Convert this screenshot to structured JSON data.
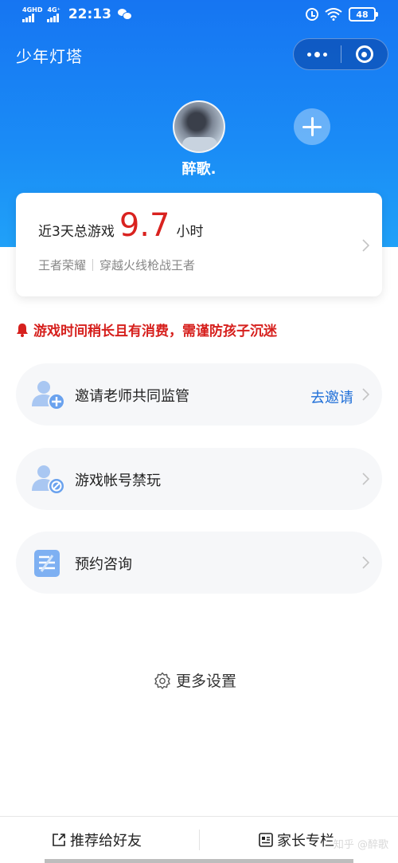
{
  "status_bar": {
    "network_1": "4GHD",
    "network_2": "4G⁺",
    "time": "22:13",
    "battery": "48",
    "icons": [
      "signal-icon",
      "wechat-icon",
      "alarm-icon",
      "wifi-icon",
      "battery-icon"
    ]
  },
  "header": {
    "title": "少年灯塔",
    "capsule_icons": [
      "more-dots-icon",
      "close-target-icon"
    ],
    "gradient": [
      "#1675f2",
      "#20a1f8"
    ]
  },
  "profile": {
    "name": "醉歌.",
    "add_icon": "plus-icon"
  },
  "stats_card": {
    "label": "近3天总游戏",
    "value": "9.7",
    "unit": "小时",
    "games": [
      "王者荣耀",
      "穿越火线枪战王者"
    ],
    "value_color": "#d9221f"
  },
  "warning": {
    "text": "游戏时间稍长且有消费，需谨防孩子沉迷",
    "color": "#d6201d"
  },
  "menu": [
    {
      "label": "邀请老师共同监管",
      "action": "去邀请",
      "icon": "invite-teacher-icon"
    },
    {
      "label": "游戏帐号禁玩",
      "icon": "ban-account-icon"
    },
    {
      "label": "预约咨询",
      "icon": "consult-icon"
    }
  ],
  "more_settings": {
    "label": "更多设置",
    "icon": "gear-icon"
  },
  "bottom_bar": {
    "share_label": "推荐给好友",
    "column_label": "家长专栏",
    "watermark": "知乎 @醉歌"
  },
  "colors": {
    "accent_link": "#1f6fd8",
    "menu_bg": "#f6f7f9"
  }
}
